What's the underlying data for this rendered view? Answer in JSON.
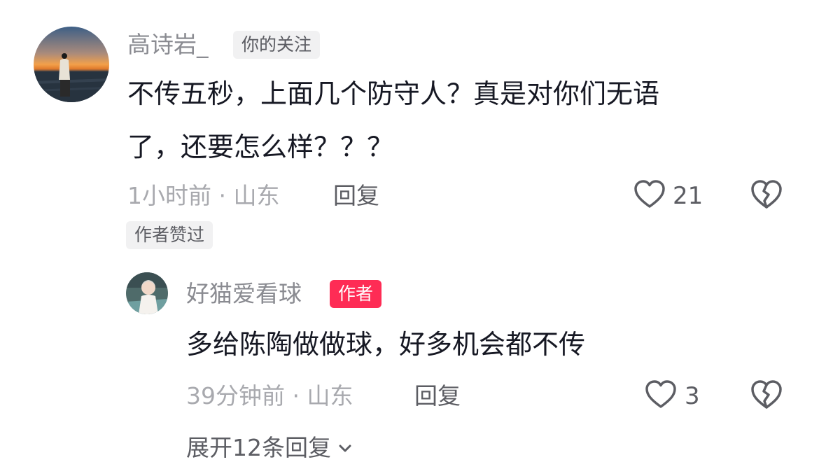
{
  "comments": [
    {
      "username": "高诗岩_",
      "tag": "你的关注",
      "text_line1": "不传五秒，上面几个防守人？真是对你们无语",
      "text_line2": "了，还要怎么样？？？",
      "meta": "1小时前 · 山东",
      "reply": "回复",
      "likes": "21",
      "liked_by_author": "作者赞过"
    }
  ],
  "reply": {
    "username": "好猫爱看球",
    "tag": "作者",
    "text": "多给陈陶做做球，好多机会都不传",
    "meta": "39分钟前 · 山东",
    "reply": "回复",
    "likes": "3"
  },
  "expand_replies": "展开12条回复",
  "colors": {
    "author_tag": "#fe2c55",
    "muted_text": "#8a8b91",
    "primary_text": "#161823"
  },
  "icons": [
    "heart-outline-icon",
    "broken-heart-icon",
    "chevron-down-icon"
  ]
}
